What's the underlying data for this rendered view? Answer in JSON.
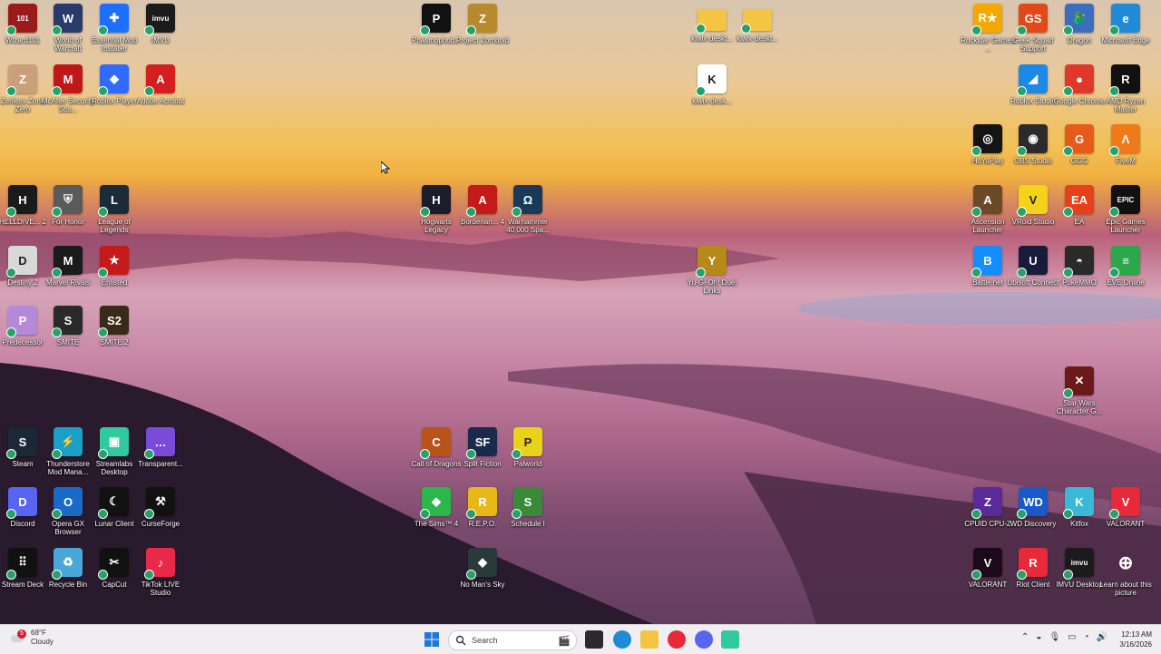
{
  "desktop": {
    "icons": [
      {
        "label": "Wizard101",
        "icon": "wizard101-icon",
        "color": "#9b1b1b",
        "glyph": "101"
      },
      {
        "label": "World of Warcraft",
        "icon": "wow-icon",
        "color": "#2a3a6a",
        "glyph": "W"
      },
      {
        "label": "Essential Mod Installer",
        "icon": "essential-icon",
        "color": "#1e6fff",
        "glyph": "✚"
      },
      {
        "label": "IMVU",
        "icon": "imvu-icon",
        "color": "#1b1b1b",
        "glyph": "imvu"
      },
      {
        "label": "Phasmophob...",
        "icon": "phasmophobia-icon",
        "color": "#111111",
        "glyph": "P"
      },
      {
        "label": "Project Zomboid",
        "icon": "zomboid-icon",
        "color": "#b9892f",
        "glyph": "Z"
      },
      {
        "label": "kiwix-deskt...",
        "icon": "folder-icon",
        "color": "#f4c542",
        "glyph": ""
      },
      {
        "label": "kiwix-deskt...",
        "icon": "folder-icon",
        "color": "#f4c542",
        "glyph": ""
      },
      {
        "label": "Rockstar Games ...",
        "icon": "rockstar-icon",
        "color": "#f3a800",
        "glyph": "R★"
      },
      {
        "label": "Geek Squad Support",
        "icon": "geeksquad-icon",
        "color": "#e04a1a",
        "glyph": "GS"
      },
      {
        "label": "Dragon",
        "icon": "dragon-icon",
        "color": "#3b6dbf",
        "glyph": "🐉"
      },
      {
        "label": "Microsoft Edge",
        "icon": "edge-icon",
        "color": "#1f8bd6",
        "glyph": "e"
      },
      {
        "label": "Zenless Zone Zero",
        "icon": "zzz-icon",
        "color": "#caa07a",
        "glyph": "Z"
      },
      {
        "label": "McAfee Security Sca...",
        "icon": "mcafee-icon",
        "color": "#c01818",
        "glyph": "M"
      },
      {
        "label": "Roblox Player",
        "icon": "roblox-icon",
        "color": "#2f6bff",
        "glyph": "◆"
      },
      {
        "label": "Adobe Acrobat",
        "icon": "acrobat-icon",
        "color": "#d31f1f",
        "glyph": "A"
      },
      {
        "label": "kiwix-desk...",
        "icon": "kiwix-icon",
        "color": "#ffffff",
        "glyph": "K"
      },
      {
        "label": "Roblox Studio",
        "icon": "roblox-studio-icon",
        "color": "#1e88e5",
        "glyph": "◢"
      },
      {
        "label": "Google Chrome",
        "icon": "chrome-icon",
        "color": "#e0392b",
        "glyph": "●"
      },
      {
        "label": "AMD Ryzen Master",
        "icon": "amd-icon",
        "color": "#111111",
        "glyph": "R"
      },
      {
        "label": "HoYoPlay",
        "icon": "hoyoplay-icon",
        "color": "#141414",
        "glyph": "◎"
      },
      {
        "label": "OBS Studio",
        "icon": "obs-icon",
        "color": "#2b2b2b",
        "glyph": "◉"
      },
      {
        "label": "GGG",
        "icon": "ggg-icon",
        "color": "#e85a1a",
        "glyph": "G"
      },
      {
        "label": "FiveM",
        "icon": "fivem-icon",
        "color": "#f07a1a",
        "glyph": "Λ"
      },
      {
        "label": "HELLDIVE... 2",
        "icon": "helldivers-icon",
        "color": "#1b1b1b",
        "glyph": "H"
      },
      {
        "label": "For Honor",
        "icon": "forhonor-icon",
        "color": "#5a5a5a",
        "glyph": "⛨"
      },
      {
        "label": "League of Legends",
        "icon": "lol-icon",
        "color": "#1a2b3a",
        "glyph": "L"
      },
      {
        "label": "Hogwarts Legacy",
        "icon": "hogwarts-icon",
        "color": "#1c1c2a",
        "glyph": "H"
      },
      {
        "label": "Borderlan... 4",
        "icon": "borderlands-icon",
        "color": "#c41a1a",
        "glyph": "A"
      },
      {
        "label": "Warhammer 40,000 Spa...",
        "icon": "warhammer-icon",
        "color": "#1b3a5a",
        "glyph": "Ω"
      },
      {
        "label": "Ascension Launcher",
        "icon": "ascension-icon",
        "color": "#6b4a2a",
        "glyph": "A"
      },
      {
        "label": "VRoid Studio",
        "icon": "vroid-icon",
        "color": "#f4d21a",
        "glyph": "V"
      },
      {
        "label": "EA",
        "icon": "ea-icon",
        "color": "#e8401a",
        "glyph": "EA"
      },
      {
        "label": "Epic Games Launcher",
        "icon": "epic-icon",
        "color": "#111111",
        "glyph": "EPIC"
      },
      {
        "label": "Destiny 2",
        "icon": "destiny-icon",
        "color": "#d8d8d8",
        "glyph": "D"
      },
      {
        "label": "Marvel Rivals",
        "icon": "marvel-icon",
        "color": "#1b1b1b",
        "glyph": "M"
      },
      {
        "label": "Enlisted",
        "icon": "enlisted-icon",
        "color": "#c41a1a",
        "glyph": "★"
      },
      {
        "label": "Yu-Gi-Oh! Duel Links",
        "icon": "yugioh-icon",
        "color": "#b58a1a",
        "glyph": "Y"
      },
      {
        "label": "Battle.net",
        "icon": "battlenet-icon",
        "color": "#148eff",
        "glyph": "B"
      },
      {
        "label": "Ubisoft Connect",
        "icon": "ubisoft-icon",
        "color": "#1a1a3a",
        "glyph": "U"
      },
      {
        "label": "PokeMMO",
        "icon": "pokemmo-icon",
        "color": "#2a2a2a",
        "glyph": "◓"
      },
      {
        "label": "EVE Online",
        "icon": "eve-icon",
        "color": "#2aa84a",
        "glyph": "≡"
      },
      {
        "label": "Predecessor",
        "icon": "predecessor-icon",
        "color": "#b48ad8",
        "glyph": "P"
      },
      {
        "label": "SMITE",
        "icon": "smite-icon",
        "color": "#2a2a2a",
        "glyph": "S"
      },
      {
        "label": "SMITE 2",
        "icon": "smite2-icon",
        "color": "#3a2a1a",
        "glyph": "S2"
      },
      {
        "label": "Star Wars Character G...",
        "icon": "starwars-icon",
        "color": "#6b1a1a",
        "glyph": "✕"
      },
      {
        "label": "Steam",
        "icon": "steam-icon",
        "color": "#1b2838",
        "glyph": "S"
      },
      {
        "label": "Thunderstore Mod Mana...",
        "icon": "thunderstore-icon",
        "color": "#1aa0c8",
        "glyph": "⚡"
      },
      {
        "label": "Streamlabs Desktop",
        "icon": "streamlabs-icon",
        "color": "#30c9a0",
        "glyph": "▣"
      },
      {
        "label": "Transparent...",
        "icon": "transparent-icon",
        "color": "#7a4ad8",
        "glyph": "…"
      },
      {
        "label": "Call of Dragons",
        "icon": "callofdragons-icon",
        "color": "#b8541a",
        "glyph": "C"
      },
      {
        "label": "Split Fiction",
        "icon": "splitfiction-icon",
        "color": "#1a2a4a",
        "glyph": "SF"
      },
      {
        "label": "Palworld",
        "icon": "palworld-icon",
        "color": "#e8d21a",
        "glyph": "P"
      },
      {
        "label": "Discord",
        "icon": "discord-icon",
        "color": "#5865f2",
        "glyph": "D"
      },
      {
        "label": "Opera GX Browser",
        "icon": "operagx-icon",
        "color": "#1a6ac8",
        "glyph": "O"
      },
      {
        "label": "Lunar Client",
        "icon": "lunar-icon",
        "color": "#111111",
        "glyph": "☾"
      },
      {
        "label": "CurseForge",
        "icon": "curseforge-icon",
        "color": "#111111",
        "glyph": "⚒"
      },
      {
        "label": "The Sims™ 4",
        "icon": "sims-icon",
        "color": "#2ab84a",
        "glyph": "◆"
      },
      {
        "label": "R.E.P.O.",
        "icon": "repo-icon",
        "color": "#e8b81a",
        "glyph": "R"
      },
      {
        "label": "Schedule I",
        "icon": "schedule-icon",
        "color": "#3a8a3a",
        "glyph": "S"
      },
      {
        "label": "CPUID CPU-Z",
        "icon": "cpuz-icon",
        "color": "#5a2a9a",
        "glyph": "Z"
      },
      {
        "label": "WD Discovery",
        "icon": "wd-icon",
        "color": "#1a5ac8",
        "glyph": "WD"
      },
      {
        "label": "Kitfox",
        "icon": "kitfox-icon",
        "color": "#3ab8d8",
        "glyph": "K"
      },
      {
        "label": "VALORANT",
        "icon": "valorant-icon",
        "color": "#e8293a",
        "glyph": "V"
      },
      {
        "label": "Stream Deck",
        "icon": "streamdeck-icon",
        "color": "#111111",
        "glyph": "⠿"
      },
      {
        "label": "Recycle Bin",
        "icon": "recycle-bin-icon",
        "color": "#4aa8d8",
        "glyph": "♻"
      },
      {
        "label": "CapCut",
        "icon": "capcut-icon",
        "color": "#111111",
        "glyph": "✂"
      },
      {
        "label": "TikTok LIVE Studio",
        "icon": "tiktok-icon",
        "color": "#e8294a",
        "glyph": "♪"
      },
      {
        "label": "No Man's Sky",
        "icon": "nomanssky-icon",
        "color": "#2a3a3a",
        "glyph": "◆"
      },
      {
        "label": "VALORANT",
        "icon": "valorant-icon",
        "color": "#1a0a1a",
        "glyph": "V"
      },
      {
        "label": "Riot Client",
        "icon": "riot-icon",
        "color": "#e8293a",
        "glyph": "R"
      },
      {
        "label": "IMVU Desktop",
        "icon": "imvu-desktop-icon",
        "color": "#1b1b1b",
        "glyph": "imvu"
      },
      {
        "label": "Learn about this picture",
        "icon": "learn-picture-icon",
        "color": "#00000000",
        "glyph": "⊕"
      }
    ]
  },
  "taskbar": {
    "weather": {
      "temp": "68°F",
      "condition": "Cloudy",
      "badge": "5"
    },
    "search": {
      "placeholder": "Search"
    },
    "clock": {
      "time": "12:13 AM",
      "date": "3/16/2026"
    },
    "apps": [
      {
        "icon": "windows-start-icon",
        "color": "#1e78d8"
      },
      {
        "icon": "task-view-icon",
        "color": "#2a2a2a"
      },
      {
        "icon": "edge-icon",
        "color": "#1f8bd6"
      },
      {
        "icon": "file-explorer-icon",
        "color": "#f4c542"
      },
      {
        "icon": "opera-gx-icon",
        "color": "#e8293a"
      },
      {
        "icon": "discord-icon",
        "color": "#5865f2"
      },
      {
        "icon": "streamlabs-icon",
        "color": "#30c9a0"
      }
    ]
  }
}
